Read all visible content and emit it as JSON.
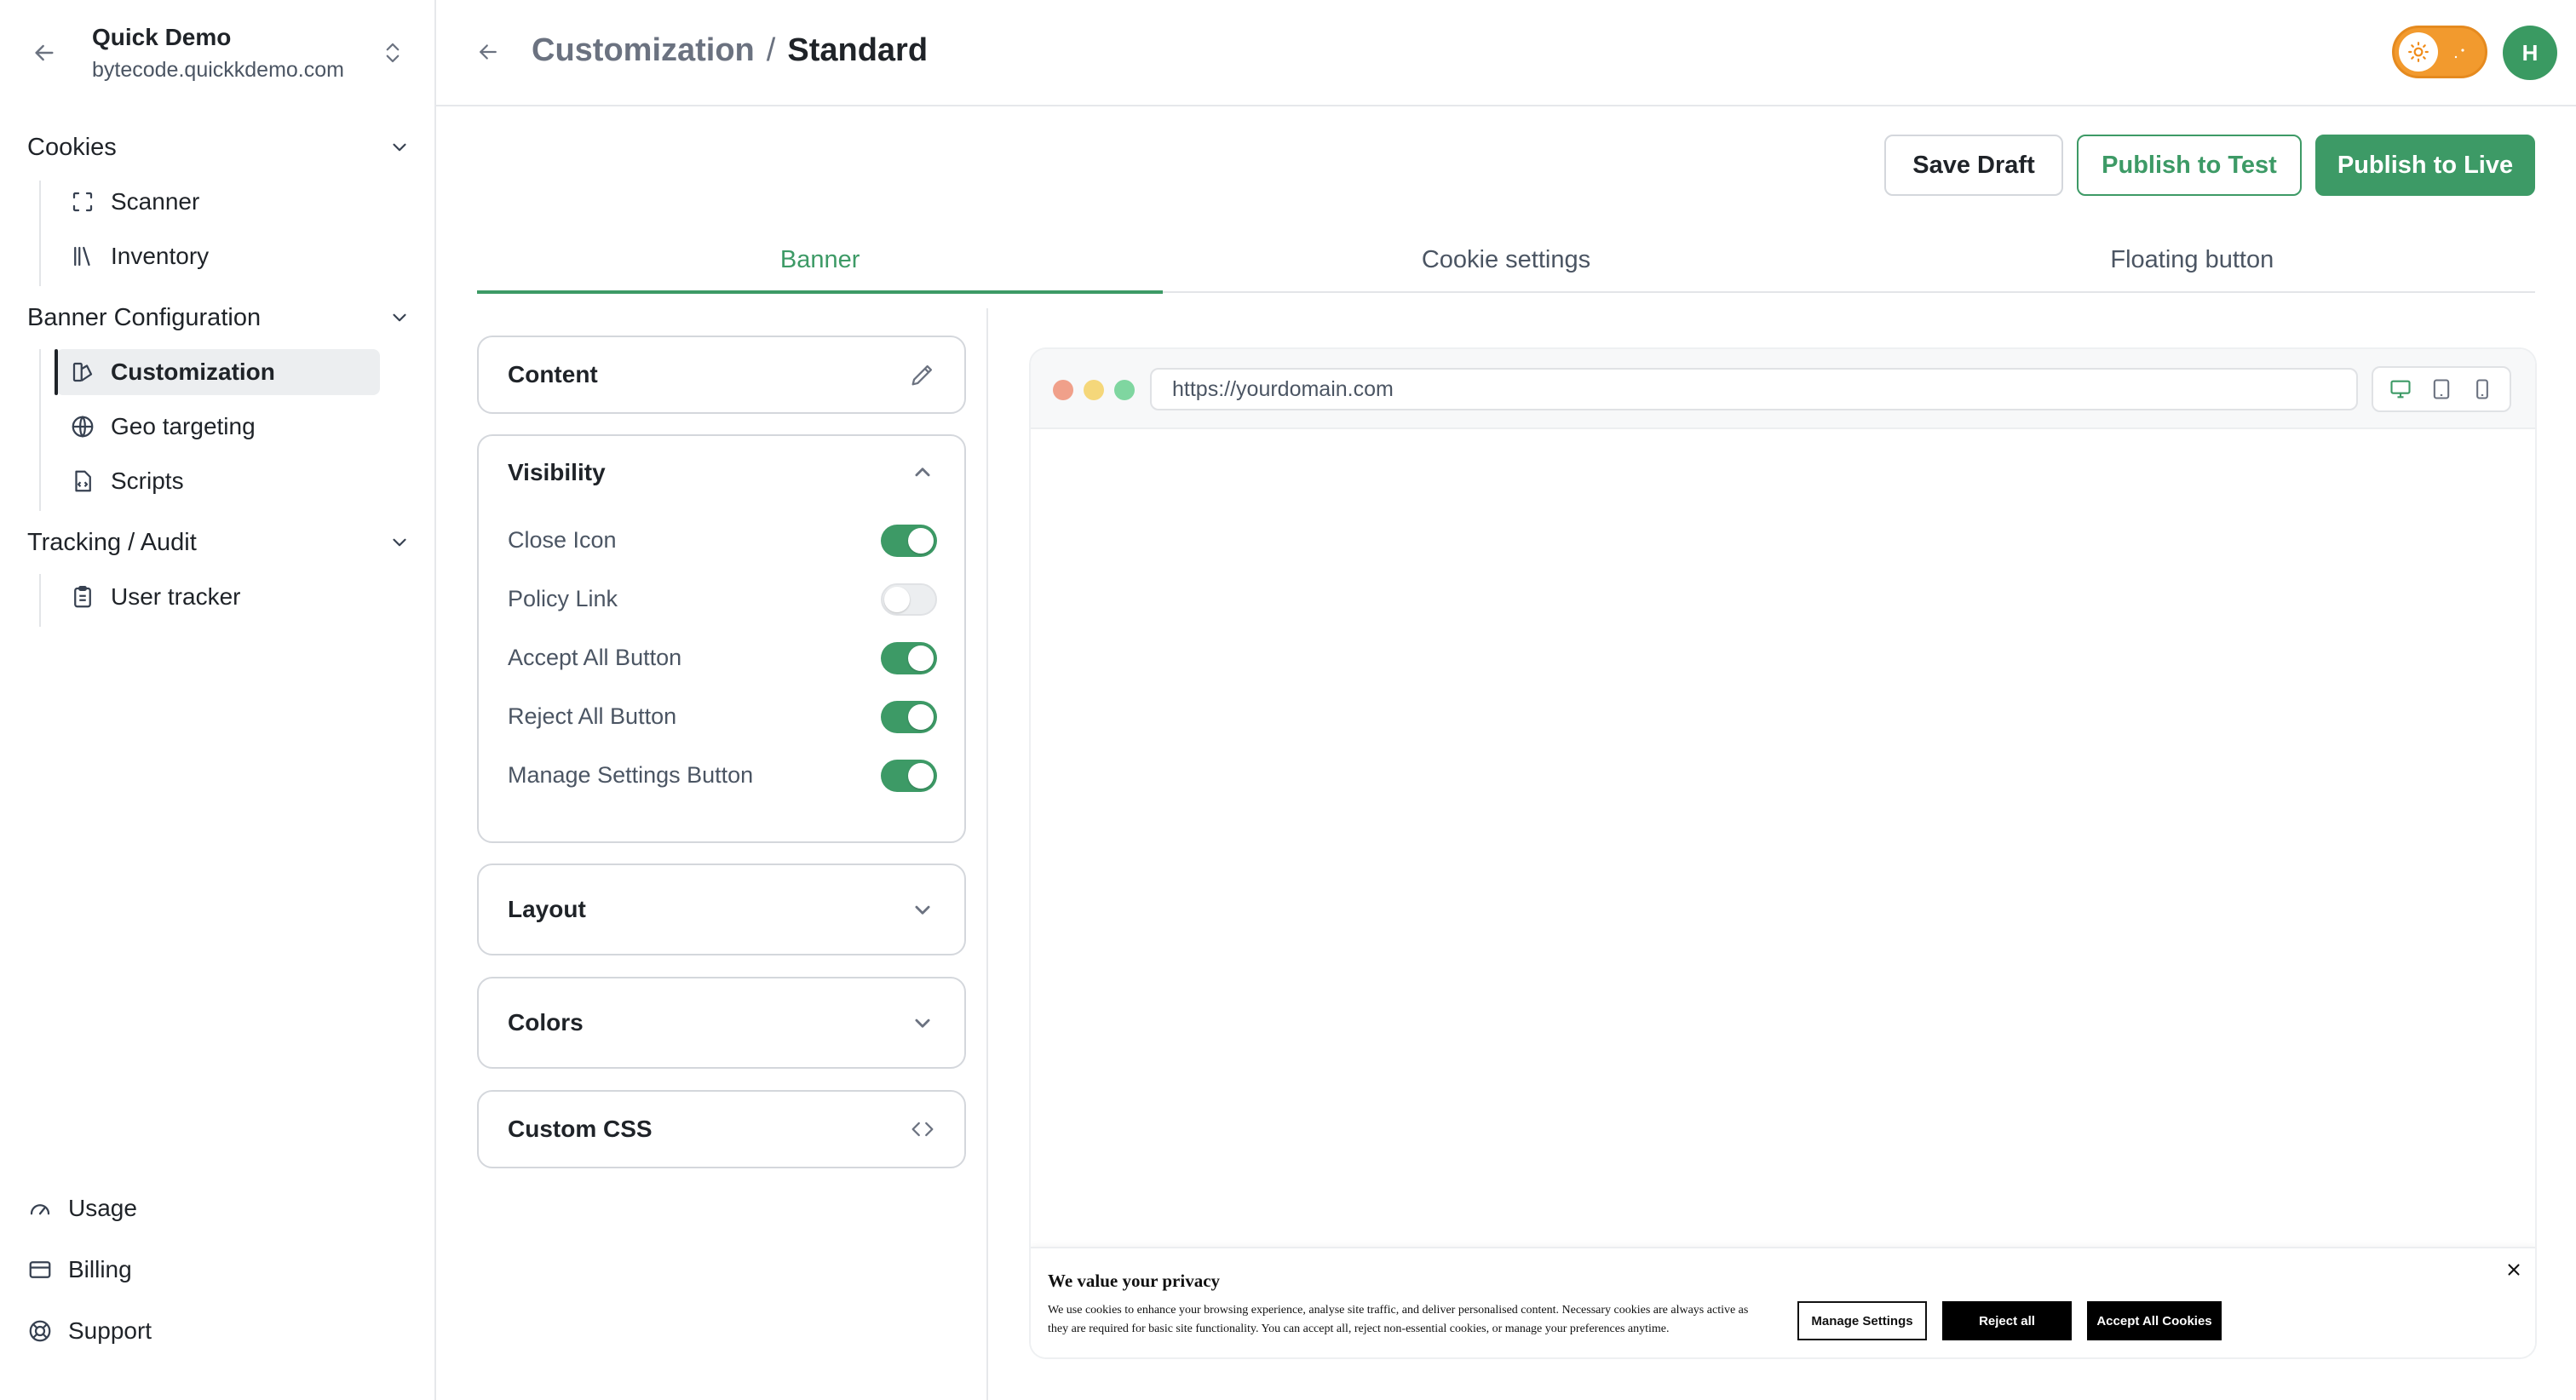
{
  "workspace": {
    "name": "Quick Demo",
    "domain": "bytecode.quickkdemo.com"
  },
  "sidebar": {
    "sections": [
      {
        "label": "Cookies",
        "items": [
          {
            "label": "Scanner",
            "icon": "scan-icon"
          },
          {
            "label": "Inventory",
            "icon": "library-icon"
          }
        ]
      },
      {
        "label": "Banner Configuration",
        "items": [
          {
            "label": "Customization",
            "icon": "palette-icon",
            "active": true
          },
          {
            "label": "Geo targeting",
            "icon": "globe-icon"
          },
          {
            "label": "Scripts",
            "icon": "file-code-icon"
          }
        ]
      },
      {
        "label": "Tracking / Audit",
        "items": [
          {
            "label": "User tracker",
            "icon": "clipboard-icon"
          }
        ]
      }
    ],
    "footer": [
      {
        "label": "Usage",
        "icon": "gauge-icon"
      },
      {
        "label": "Billing",
        "icon": "credit-card-icon"
      },
      {
        "label": "Support",
        "icon": "life-buoy-icon"
      }
    ]
  },
  "header": {
    "breadcrumb_parent": "Customization",
    "breadcrumb_separator": "/",
    "breadcrumb_current": "Standard",
    "avatar_initial": "H",
    "theme_toggle": "light"
  },
  "actions": {
    "save_draft": "Save Draft",
    "publish_test": "Publish to Test",
    "publish_live": "Publish to Live"
  },
  "tabs": [
    {
      "label": "Banner",
      "active": true
    },
    {
      "label": "Cookie settings"
    },
    {
      "label": "Floating button"
    }
  ],
  "panels": {
    "content": {
      "title": "Content"
    },
    "visibility": {
      "title": "Visibility",
      "toggles": [
        {
          "label": "Close Icon",
          "on": true
        },
        {
          "label": "Policy Link",
          "on": false
        },
        {
          "label": "Accept All Button",
          "on": true
        },
        {
          "label": "Reject All Button",
          "on": true
        },
        {
          "label": "Manage Settings Button",
          "on": true
        }
      ]
    },
    "layout": {
      "title": "Layout"
    },
    "colors": {
      "title": "Colors"
    },
    "custom_css": {
      "title": "Custom CSS"
    }
  },
  "preview": {
    "url": "https://yourdomain.com",
    "devices": [
      "desktop-icon",
      "tablet-icon",
      "mobile-icon"
    ],
    "selected_device": "desktop-icon",
    "banner": {
      "title": "We value your privacy",
      "body": "We use cookies to enhance your browsing experience, analyse site traffic, and deliver personalised content. Necessary cookies are always active as they are required for basic site functionality. You can accept all, reject non-essential cookies, or manage your preferences anytime.",
      "manage_label": "Manage Settings",
      "reject_label": "Reject all",
      "accept_label": "Accept All Cookies"
    }
  },
  "colors": {
    "accent": "#3d9a66",
    "theme_toggle": "#f29a2e",
    "dot_red": "#f0a08a",
    "dot_yellow": "#f5d77a",
    "dot_green": "#7fd6a0"
  }
}
